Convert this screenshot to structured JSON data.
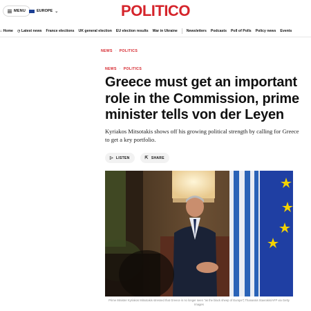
{
  "header": {
    "menu_label": "MENU",
    "edition_label": "EUROPE",
    "logo_text": "POLITICO",
    "brand_color": "#d5242b"
  },
  "nav": {
    "items": [
      {
        "label": "Home",
        "icon": "home-icon"
      },
      {
        "label": "Latest news",
        "icon": "clock-icon"
      },
      {
        "label": "France elections"
      },
      {
        "label": "UK general election"
      },
      {
        "label": "EU election results"
      },
      {
        "label": "War in Ukraine"
      },
      {
        "label": "Newsletters"
      },
      {
        "label": "Podcasts"
      },
      {
        "label": "Poll of Polls"
      },
      {
        "label": "Policy news"
      },
      {
        "label": "Events"
      }
    ]
  },
  "breadcrumb_top": {
    "section": "NEWS",
    "subsection": "POLITICS"
  },
  "article": {
    "breadcrumb": {
      "section": "NEWS",
      "subsection": "POLITICS"
    },
    "headline": "Greece must get an important role in the Commission, prime minister tells von der Leyen",
    "dek": "Kyriakos Mitsotakis shows off his growing political strength by calling for Greece to get a key portfolio.",
    "listen_label": "LISTEN",
    "share_label": "SHARE",
    "photo_caption": "Prime Minister Kyriakos Mitsotakis stressed that Greece is no longer seen \"as the black sheep of Europe\"| Thanassis Stavrakis/AFP via Getty Images"
  }
}
